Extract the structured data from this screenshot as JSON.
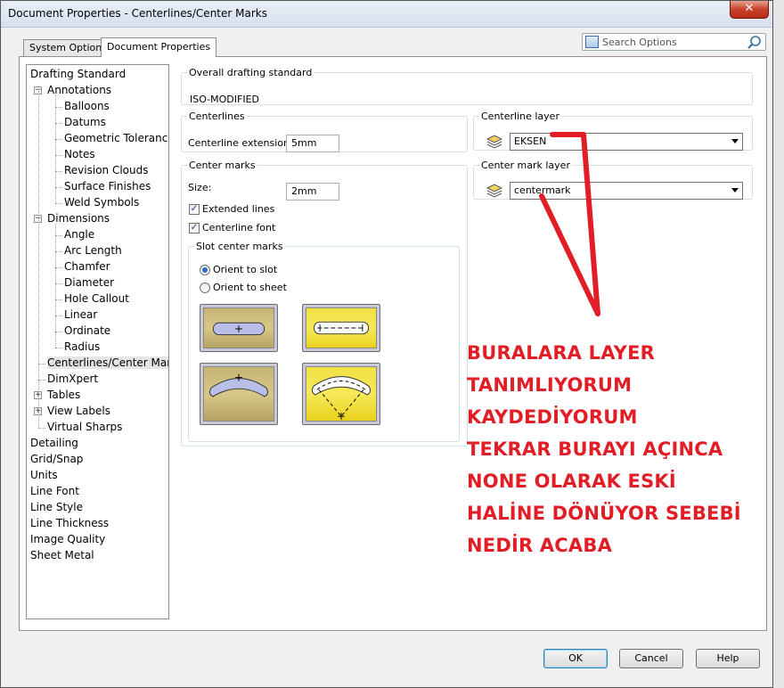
{
  "window": {
    "title": "Document Properties - Centerlines/Center Marks",
    "close_glyph": "✕"
  },
  "tabs": [
    {
      "label": "System Options",
      "active": false
    },
    {
      "label": "Document Properties",
      "active": true
    }
  ],
  "search": {
    "placeholder": "Search Options"
  },
  "tree": {
    "items": [
      {
        "label": "Drafting Standard",
        "level": 0
      },
      {
        "label": "Annotations",
        "level": 1,
        "expander": "-"
      },
      {
        "label": "Balloons",
        "level": 2
      },
      {
        "label": "Datums",
        "level": 2
      },
      {
        "label": "Geometric Tolerances",
        "level": 2
      },
      {
        "label": "Notes",
        "level": 2
      },
      {
        "label": "Revision Clouds",
        "level": 2
      },
      {
        "label": "Surface Finishes",
        "level": 2
      },
      {
        "label": "Weld Symbols",
        "level": 2
      },
      {
        "label": "Dimensions",
        "level": 1,
        "expander": "-"
      },
      {
        "label": "Angle",
        "level": 2
      },
      {
        "label": "Arc Length",
        "level": 2
      },
      {
        "label": "Chamfer",
        "level": 2
      },
      {
        "label": "Diameter",
        "level": 2
      },
      {
        "label": "Hole Callout",
        "level": 2
      },
      {
        "label": "Linear",
        "level": 2
      },
      {
        "label": "Ordinate",
        "level": 2
      },
      {
        "label": "Radius",
        "level": 2
      },
      {
        "label": "Centerlines/Center Marks",
        "level": 1,
        "selected": true
      },
      {
        "label": "DimXpert",
        "level": 1
      },
      {
        "label": "Tables",
        "level": 1,
        "expander": "+"
      },
      {
        "label": "View Labels",
        "level": 1,
        "expander": "+"
      },
      {
        "label": "Virtual Sharps",
        "level": 1
      },
      {
        "label": "Detailing",
        "level": 0
      },
      {
        "label": "Grid/Snap",
        "level": 0
      },
      {
        "label": "Units",
        "level": 0
      },
      {
        "label": "Line Font",
        "level": 0
      },
      {
        "label": "Line Style",
        "level": 0
      },
      {
        "label": "Line Thickness",
        "level": 0
      },
      {
        "label": "Image Quality",
        "level": 0
      },
      {
        "label": "Sheet Metal",
        "level": 0
      }
    ]
  },
  "overall": {
    "legend": "Overall drafting standard",
    "value": "ISO-MODIFIED"
  },
  "centerlines": {
    "legend": "Centerlines",
    "extension_label": "Centerline extension:",
    "extension_value": "5mm"
  },
  "center_marks": {
    "legend": "Center marks",
    "size_label": "Size:",
    "size_value": "2mm",
    "extended_lines_label": "Extended lines",
    "extended_lines_checked": true,
    "centerline_font_label": "Centerline font",
    "centerline_font_checked": true,
    "check_glyph": "✓"
  },
  "slot_center_marks": {
    "legend": "Slot center marks",
    "orient_to_slot_label": "Orient to slot",
    "orient_to_sheet_label": "Orient to sheet",
    "selected": "orient_to_slot"
  },
  "centerline_layer": {
    "legend": "Centerline layer",
    "value": "EKSEN"
  },
  "center_mark_layer": {
    "legend": "Center mark layer",
    "value": "centermark"
  },
  "buttons": {
    "ok": "OK",
    "cancel": "Cancel",
    "help": "Help"
  },
  "annotation": {
    "color": "#e11d26",
    "lines": [
      "BURALARA LAYER",
      "TANIMLIYORUM",
      "KAYDEDİYORUM",
      "TEKRAR BURAYI AÇINCA",
      "NONE OLARAK ESKİ",
      "HALİNE DÖNÜYOR SEBEBİ",
      "NEDİR ACABA"
    ]
  }
}
